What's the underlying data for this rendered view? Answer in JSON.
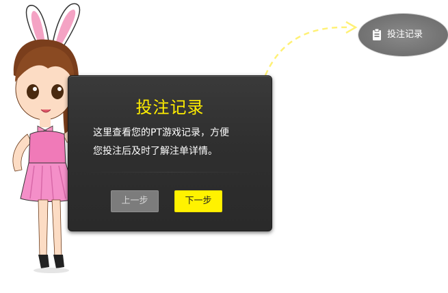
{
  "dialog": {
    "title": "投注记录",
    "body_line1": "这里查看您的PT游戏记录，方便",
    "body_line2": "您投注后及时了解注单详情。",
    "prev_label": "上一步",
    "next_label": "下一步"
  },
  "nav_target": {
    "label": "投注记录",
    "icon": "clipboard-icon"
  },
  "colors": {
    "title": "#ffee00",
    "next_button": "#fff200",
    "prev_button": "#7c7c7c",
    "dialog_bg": "#2f2f2f",
    "arrow": "#fff176"
  }
}
